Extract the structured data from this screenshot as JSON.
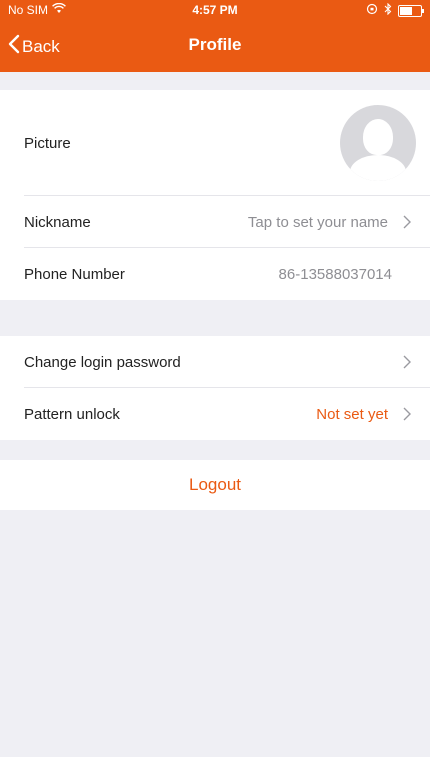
{
  "status_bar": {
    "carrier": "No SIM",
    "time": "4:57 PM"
  },
  "navbar": {
    "back_label": "Back",
    "title": "Profile"
  },
  "profile": {
    "picture_label": "Picture",
    "nickname_label": "Nickname",
    "nickname_placeholder": "Tap to set your name",
    "phone_label": "Phone Number",
    "phone_value": "86-13588037014"
  },
  "security": {
    "change_password_label": "Change login password",
    "pattern_unlock_label": "Pattern unlock",
    "pattern_unlock_value": "Not set yet"
  },
  "logout_label": "Logout",
  "colors": {
    "accent": "#ea5a13",
    "background": "#efeff4"
  }
}
